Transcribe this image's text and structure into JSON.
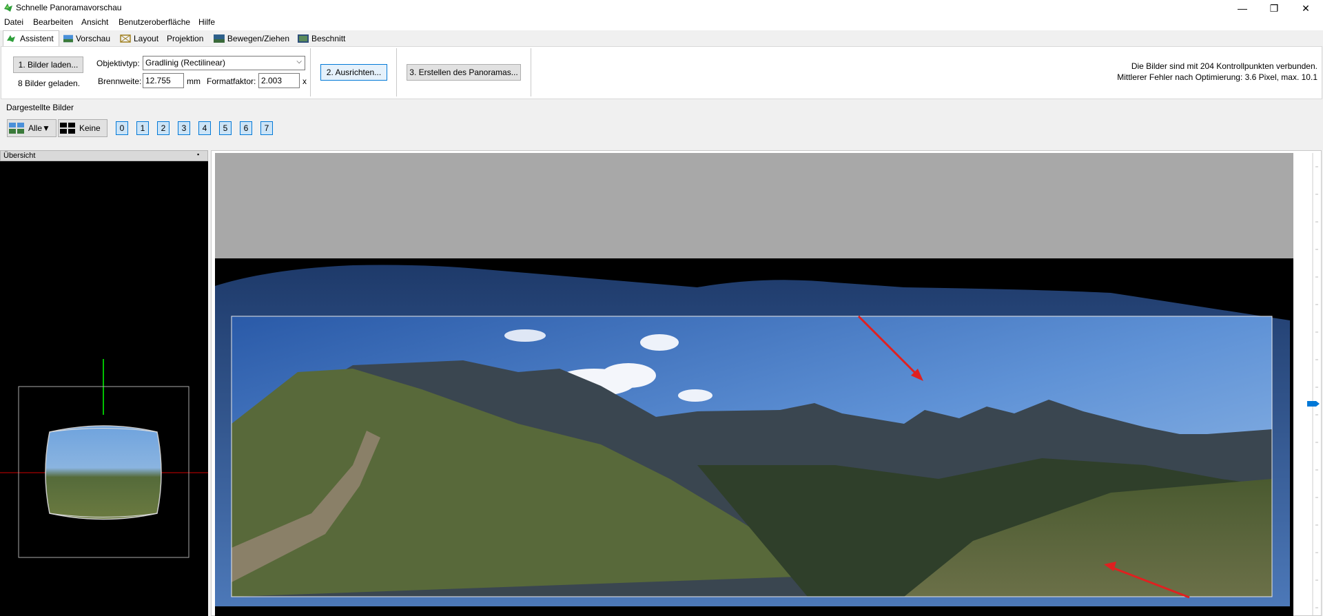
{
  "window": {
    "title": "Schnelle Panoramavorschau",
    "minimize_glyph": "—",
    "maximize_glyph": "❐",
    "close_glyph": "✕"
  },
  "menu": {
    "items": [
      "Datei",
      "Bearbeiten",
      "Ansicht",
      "Benutzeroberfläche",
      "Hilfe"
    ]
  },
  "tabs": [
    {
      "label": "Assistent",
      "icon": "wizard-icon",
      "active": true
    },
    {
      "label": "Vorschau",
      "icon": "preview-icon"
    },
    {
      "label": "Layout",
      "icon": "layout-icon"
    },
    {
      "label": "Projektion",
      "icon": "projection-icon"
    },
    {
      "label": "Bewegen/Ziehen",
      "icon": "move-icon"
    },
    {
      "label": "Beschnitt",
      "icon": "crop-icon"
    }
  ],
  "assistant": {
    "load_button": "1. Bilder laden...",
    "loaded_status": "8 Bilder geladen.",
    "lens_type_label": "Objektivtyp:",
    "lens_type_value": "Gradlinig (Rectilinear)",
    "focal_length_label": "Brennweite:",
    "focal_length_value": "12.755",
    "focal_length_unit": "mm",
    "crop_factor_label": "Formatfaktor:",
    "crop_factor_value": "2.003",
    "crop_factor_unit": "x",
    "align_button": "2. Ausrichten...",
    "create_button": "3. Erstellen des Panoramas...",
    "status_line1": "Die Bilder sind mit 204 Kontrollpunkten verbunden.",
    "status_line2": "Mittlerer Fehler nach Optimierung: 3.6 Pixel, max. 10.1"
  },
  "displayed_images": {
    "label": "Dargestellte Bilder",
    "all_button": "Alle▼",
    "none_button": "Keine",
    "image_numbers": [
      "0",
      "1",
      "2",
      "3",
      "4",
      "5",
      "6",
      "7"
    ]
  },
  "overview": {
    "title": "Übersicht",
    "pin_glyph": "📌"
  },
  "colors": {
    "accent": "#0078d7",
    "arrow": "#e02020",
    "axis_green": "#00c000",
    "axis_red": "#d00000"
  }
}
